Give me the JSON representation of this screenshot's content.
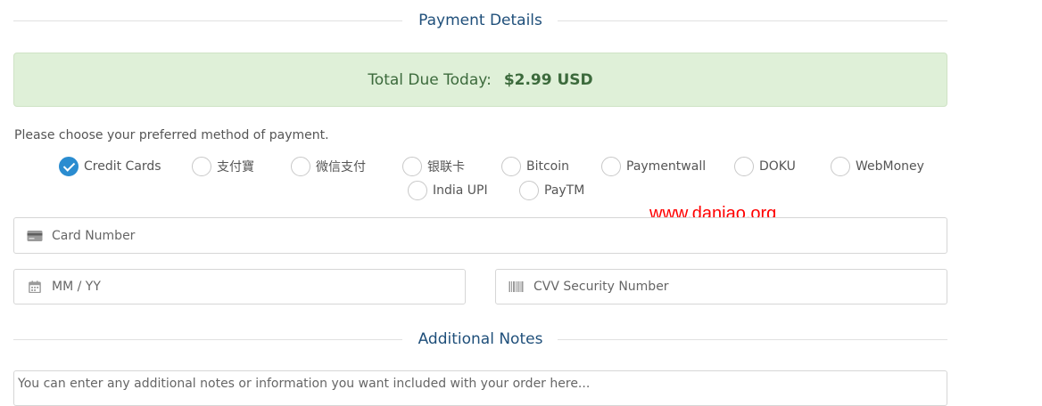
{
  "payment_section": {
    "title": "Payment Details"
  },
  "total_due": {
    "label": "Total Due Today:",
    "amount": "$2.99 USD"
  },
  "payment_method": {
    "prompt": "Please choose your preferred method of payment.",
    "selected": "Credit Cards",
    "options": [
      {
        "label": "Credit Cards"
      },
      {
        "label": "支付寶"
      },
      {
        "label": "微信支付"
      },
      {
        "label": "银联卡"
      },
      {
        "label": "Bitcoin"
      },
      {
        "label": "Paymentwall"
      },
      {
        "label": "DOKU"
      },
      {
        "label": "WebMoney"
      },
      {
        "label": "India UPI"
      },
      {
        "label": "PayTM"
      }
    ]
  },
  "card_form": {
    "card_number_placeholder": "Card Number",
    "expiry_placeholder": "MM / YY",
    "cvv_placeholder": "CVV Security Number"
  },
  "notes_section": {
    "title": "Additional Notes",
    "placeholder": "You can enter any additional notes or information you want included with your order here..."
  },
  "watermark": "www.daniao.org",
  "colors": {
    "accent": "#2a8cd0",
    "heading": "#1f4f7a",
    "success_bg": "#dff0d8",
    "success_text": "#3c6a3c",
    "watermark": "#ff0000"
  },
  "icons": {
    "card_number": "credit-card-icon",
    "expiry": "calendar-icon",
    "cvv": "barcode-icon"
  }
}
